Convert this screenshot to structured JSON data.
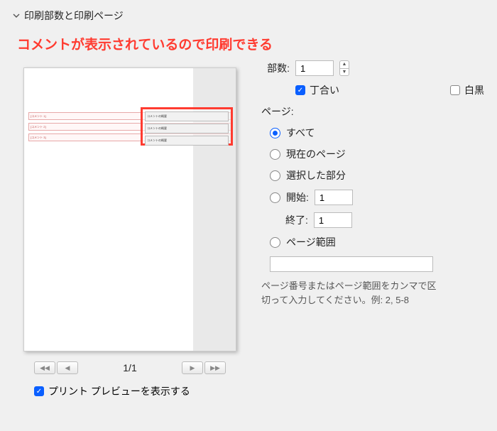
{
  "section": {
    "title": "印刷部数と印刷ページ"
  },
  "annotation": "コメントが表示されているので印刷できる",
  "preview": {
    "tags": [
      "[コメント 1]",
      "[コメント 2]",
      "[コメント 3]"
    ],
    "comments_label": "コメントの概要",
    "page_indicator": "1/1",
    "show_preview_label": "プリント プレビューを表示する",
    "show_preview_checked": true
  },
  "copies": {
    "label": "部数:",
    "value": "1",
    "collate_label": "丁合い",
    "collate_checked": true,
    "bw_label": "白黒",
    "bw_checked": false
  },
  "pages": {
    "label": "ページ:",
    "options": {
      "all": "すべて",
      "current": "現在のページ",
      "selection": "選択した部分",
      "from_label": "開始:",
      "from_value": "1",
      "to_label": "終了:",
      "to_value": "1",
      "range_label": "ページ範囲",
      "range_value": ""
    },
    "selected": "all",
    "hint": "ページ番号またはページ範囲をカンマで区切って入力してください。例: 2, 5-8"
  }
}
